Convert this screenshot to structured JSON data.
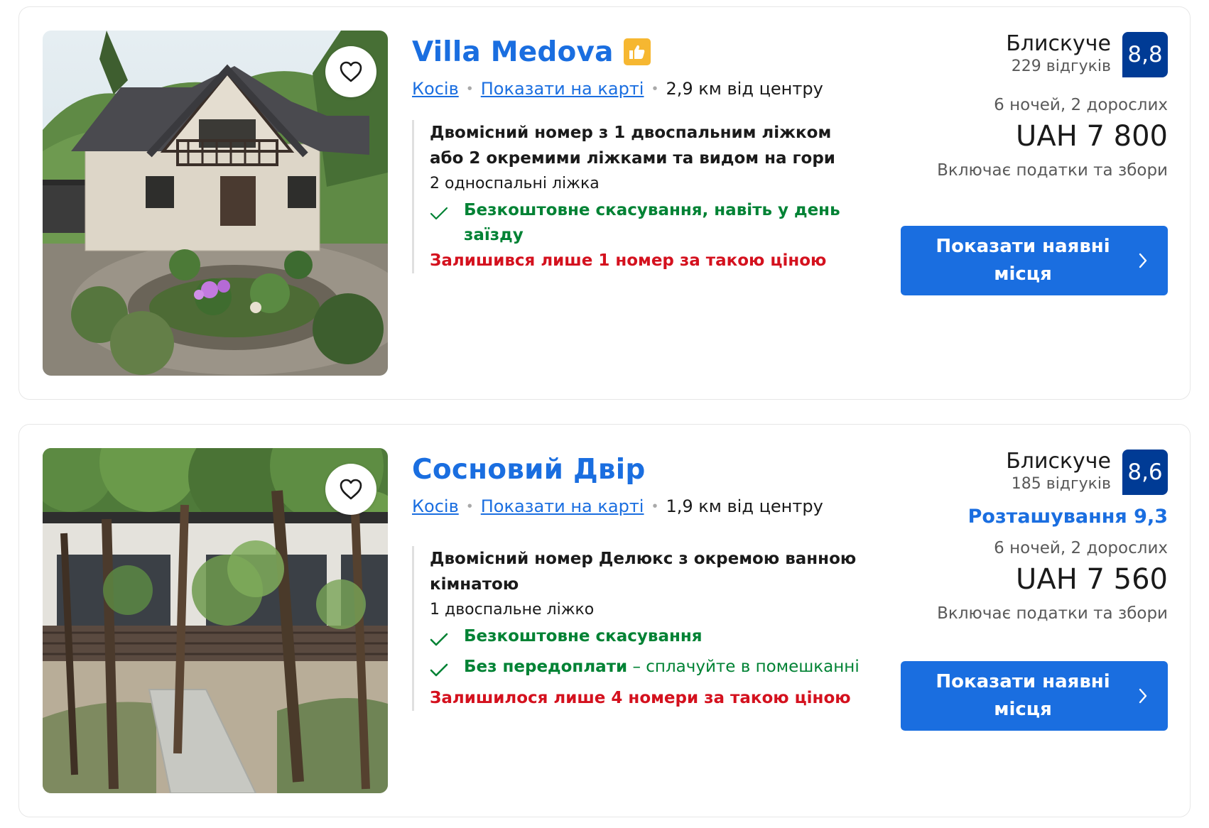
{
  "listings": [
    {
      "name": "Villa Medova",
      "has_thumb_badge": true,
      "city_link": "Косів",
      "map_link": "Показати на карті",
      "distance": "2,9 км від центру",
      "room_title": "Двомісний номер з 1 двоспальним ліжком або 2 окремими ліжками та видом на гори",
      "beds": "2 односпальні ліжка",
      "feature1": "Безкоштовне скасування, навіть у день заїзду",
      "scarcity": "Залишився лише 1 номер за такою ціною",
      "score_word": "Блискуче",
      "reviews": "229 відгуків",
      "score": "8,8",
      "stay": "6 ночей, 2 дорослих",
      "price": "UAH 7 800",
      "taxes": "Включає податки та збори",
      "cta": "Показати наявні місця"
    },
    {
      "name": "Сосновий Двір",
      "city_link": "Косів",
      "map_link": "Показати на карті",
      "distance": "1,9 км від центру",
      "room_title": "Двомісний номер Делюкс з окремою ванною кімнатою",
      "beds": "1 двоспальне ліжко",
      "feature1": "Безкоштовне скасування",
      "feature2_bold": "Без передоплати",
      "feature2_rest": " – сплачуйте в помешканні",
      "scarcity": "Залишилося лише 4 номери за такою ціною",
      "score_word": "Блискуче",
      "reviews": "185 відгуків",
      "score": "8,6",
      "location_score": "Розташування 9,3",
      "stay": "6 ночей, 2 дорослих",
      "price": "UAH 7 560",
      "taxes": "Включає податки та збори",
      "cta": "Показати наявні місця"
    }
  ],
  "icons": {
    "favorite": "heart-outline-icon",
    "check": "checkmark-icon",
    "chevron": "chevron-right-icon",
    "thumb": "thumbs-up-icon"
  },
  "colors": {
    "link_blue": "#1a6ee0",
    "score_navy": "#003b95",
    "green": "#008234",
    "red": "#d4111e",
    "badge_yellow": "#f6b731"
  }
}
